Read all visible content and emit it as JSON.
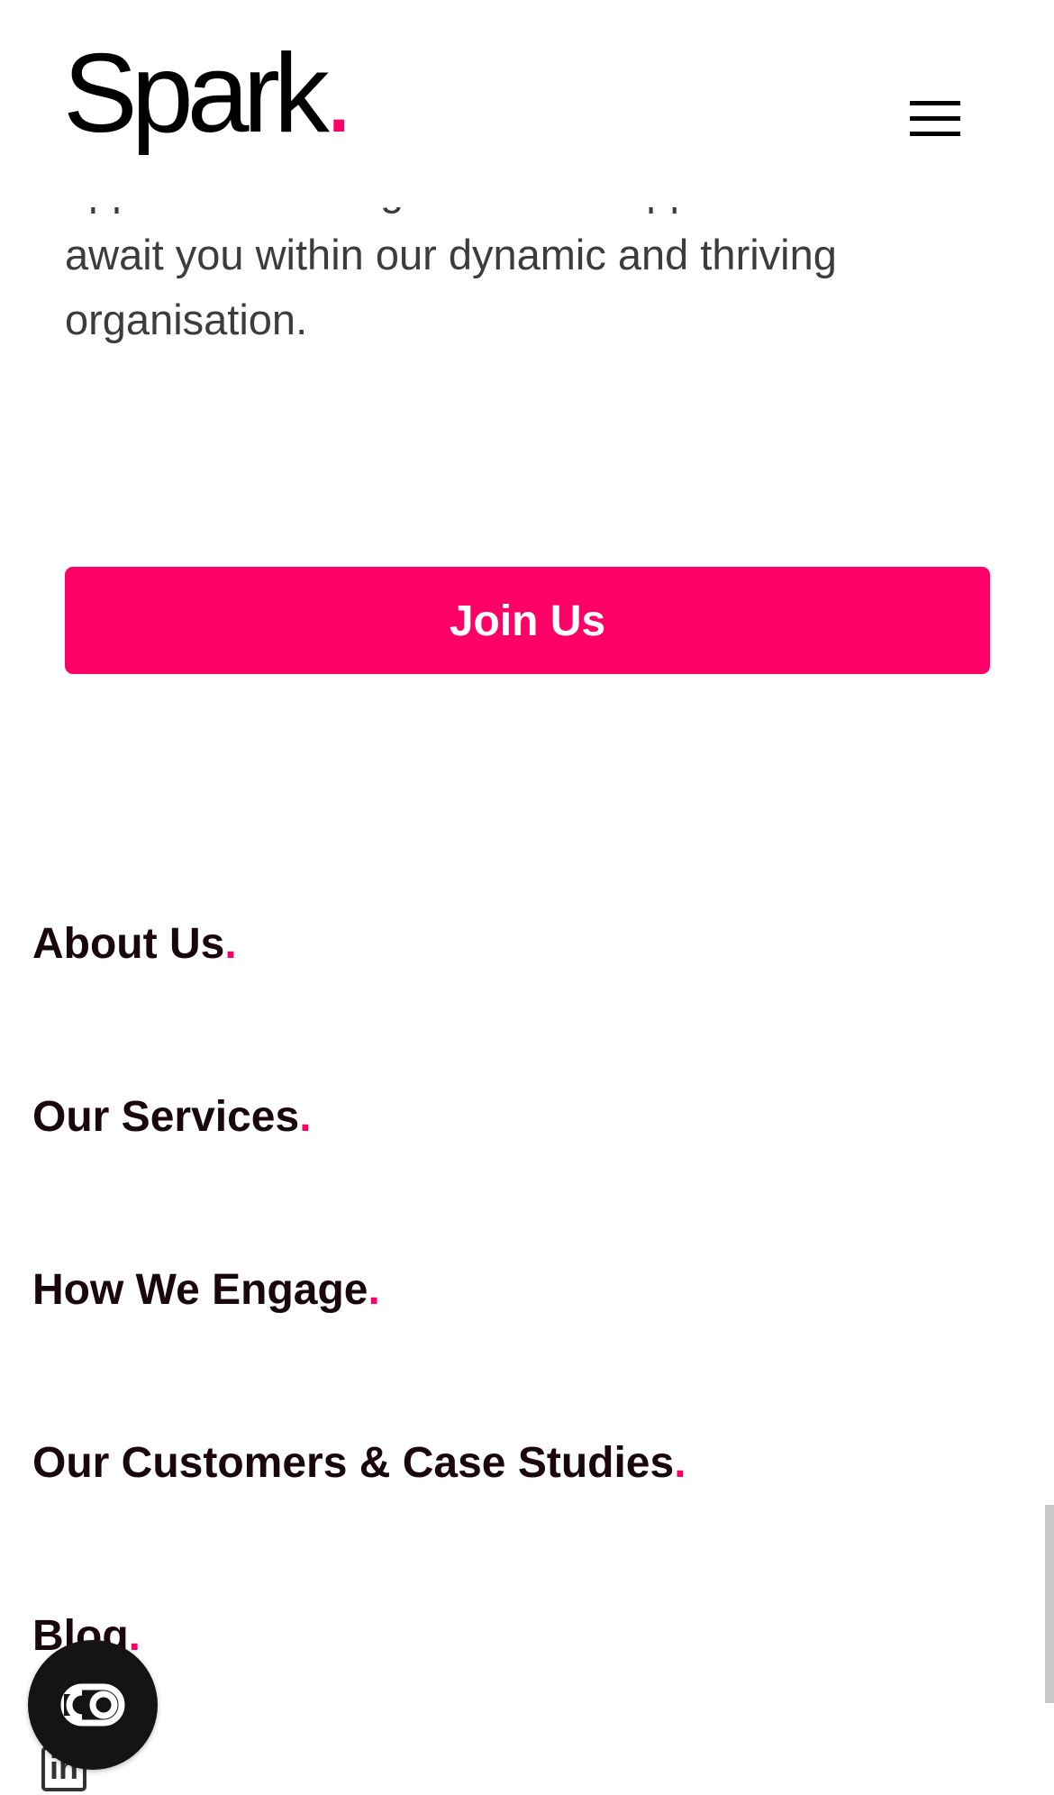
{
  "header": {
    "logo_text": "Spark",
    "logo_dot": ".",
    "menu_icon": "hamburger-menu-icon"
  },
  "intro": {
    "line_cut": "opportunities for growth and support",
    "line_1": "await you within our dynamic and thriving",
    "line_2": "organisation."
  },
  "cta": {
    "label": "Join Us"
  },
  "footer_nav": {
    "dot": ".",
    "items": [
      {
        "label": "About Us"
      },
      {
        "label": "Our Services"
      },
      {
        "label": "How We Engage"
      },
      {
        "label": "Our Customers & Case Studies"
      },
      {
        "label": "Blog"
      }
    ]
  },
  "social": {
    "linkedin_icon": "linkedin-icon",
    "linkedin_glyph": "in"
  },
  "floating_button": {
    "icon": "accessibility-toggle-icon"
  },
  "colors": {
    "accent": "#ff0066",
    "text_dark": "#1a060d",
    "body_text": "#3c3c3c"
  }
}
